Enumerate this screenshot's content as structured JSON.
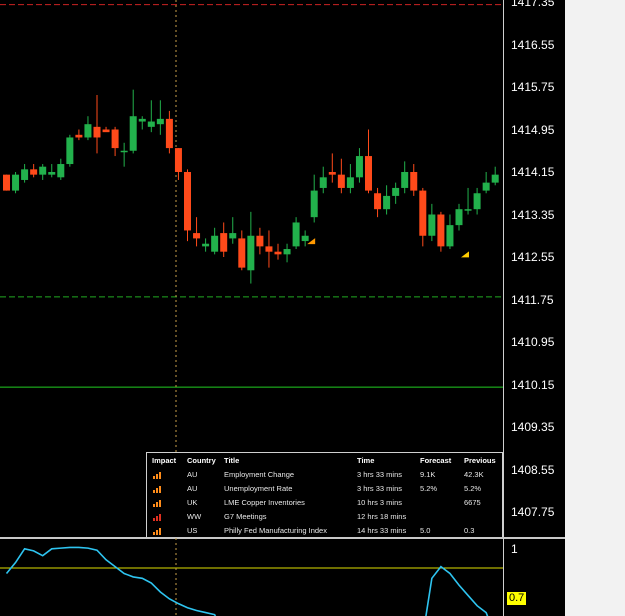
{
  "price_scale": {
    "labels": [
      "1417.35",
      "1416.55",
      "1415.75",
      "1414.95",
      "1414.15",
      "1413.35",
      "1412.55",
      "1411.75",
      "1410.95",
      "1410.15",
      "1409.35",
      "1408.55",
      "1407.75"
    ]
  },
  "news_table": {
    "headers": {
      "impact": "Impact",
      "country": "Country",
      "title": "Title",
      "time": "Time",
      "forecast": "Forecast",
      "previous": "Previous"
    },
    "rows": [
      {
        "impact": "medium",
        "country": "AU",
        "title": "Employment Change",
        "time": "3 hrs 33 mins",
        "forecast": "9.1K",
        "previous": "42.3K"
      },
      {
        "impact": "medium",
        "country": "AU",
        "title": "Unemployment Rate",
        "time": "3 hrs 33 mins",
        "forecast": "5.2%",
        "previous": "5.2%"
      },
      {
        "impact": "medium",
        "country": "UK",
        "title": "LME Copper Inventories",
        "time": "10 hrs 3 mins",
        "forecast": "",
        "previous": "6675"
      },
      {
        "impact": "high",
        "country": "WW",
        "title": "G7 Meetings",
        "time": "12 hrs 18 mins",
        "forecast": "",
        "previous": ""
      },
      {
        "impact": "medium",
        "country": "US",
        "title": "Philly Fed Manufacturing Index",
        "time": "14 hrs 33 mins",
        "forecast": "5.0",
        "previous": "0.3"
      }
    ]
  },
  "indicator": {
    "label_top": "1",
    "label_level": "0.7",
    "level": 0.7
  },
  "chart_data": {
    "type": "candlestick",
    "y_axis_ticks": [
      1417.35,
      1416.55,
      1415.75,
      1414.95,
      1414.15,
      1413.35,
      1412.55,
      1411.75,
      1410.95,
      1410.15,
      1409.35,
      1408.55,
      1407.75
    ],
    "horizontal_lines": [
      {
        "price": 1417.3,
        "color": "#cc2222",
        "style": "dashed"
      },
      {
        "price": 1411.8,
        "color": "#22aa22",
        "style": "dashed"
      },
      {
        "price": 1410.1,
        "color": "#22cc22",
        "style": "solid"
      }
    ],
    "candles": [
      {
        "o": 1414.1,
        "h": 1414.1,
        "l": 1413.8,
        "c": 1413.8
      },
      {
        "o": 1413.8,
        "h": 1414.15,
        "l": 1413.75,
        "c": 1414.1
      },
      {
        "o": 1414.0,
        "h": 1414.3,
        "l": 1413.95,
        "c": 1414.2
      },
      {
        "o": 1414.2,
        "h": 1414.3,
        "l": 1414.05,
        "c": 1414.1
      },
      {
        "o": 1414.1,
        "h": 1414.3,
        "l": 1414.0,
        "c": 1414.25
      },
      {
        "o": 1414.1,
        "h": 1414.3,
        "l": 1414.05,
        "c": 1414.15
      },
      {
        "o": 1414.05,
        "h": 1414.4,
        "l": 1414.0,
        "c": 1414.3
      },
      {
        "o": 1414.3,
        "h": 1414.85,
        "l": 1414.25,
        "c": 1414.8
      },
      {
        "o": 1414.85,
        "h": 1414.95,
        "l": 1414.75,
        "c": 1414.8
      },
      {
        "o": 1414.8,
        "h": 1415.2,
        "l": 1414.75,
        "c": 1415.05
      },
      {
        "o": 1415.0,
        "h": 1415.6,
        "l": 1414.5,
        "c": 1414.8
      },
      {
        "o": 1414.95,
        "h": 1415.0,
        "l": 1414.95,
        "c": 1414.9
      },
      {
        "o": 1414.95,
        "h": 1415.0,
        "l": 1414.45,
        "c": 1414.6
      },
      {
        "o": 1414.55,
        "h": 1414.7,
        "l": 1414.25,
        "c": 1414.55
      },
      {
        "o": 1414.55,
        "h": 1415.7,
        "l": 1414.5,
        "c": 1415.2
      },
      {
        "o": 1415.1,
        "h": 1415.2,
        "l": 1414.95,
        "c": 1415.15
      },
      {
        "o": 1415.0,
        "h": 1415.5,
        "l": 1414.9,
        "c": 1415.1
      },
      {
        "o": 1415.05,
        "h": 1415.5,
        "l": 1414.85,
        "c": 1415.15
      },
      {
        "o": 1415.15,
        "h": 1415.3,
        "l": 1414.5,
        "c": 1414.6
      },
      {
        "o": 1414.6,
        "h": 1414.6,
        "l": 1414.0,
        "c": 1414.15
      },
      {
        "o": 1414.15,
        "h": 1414.2,
        "l": 1412.85,
        "c": 1413.05
      },
      {
        "o": 1413.0,
        "h": 1413.3,
        "l": 1412.75,
        "c": 1412.9
      },
      {
        "o": 1412.75,
        "h": 1412.9,
        "l": 1412.65,
        "c": 1412.8
      },
      {
        "o": 1412.65,
        "h": 1413.1,
        "l": 1412.6,
        "c": 1412.95
      },
      {
        "o": 1413.0,
        "h": 1413.2,
        "l": 1412.55,
        "c": 1412.65
      },
      {
        "o": 1412.9,
        "h": 1413.3,
        "l": 1412.8,
        "c": 1413.0
      },
      {
        "o": 1412.9,
        "h": 1413.05,
        "l": 1412.3,
        "c": 1412.35
      },
      {
        "o": 1412.3,
        "h": 1413.4,
        "l": 1412.05,
        "c": 1412.95
      },
      {
        "o": 1412.95,
        "h": 1413.1,
        "l": 1412.6,
        "c": 1412.75
      },
      {
        "o": 1412.75,
        "h": 1413.05,
        "l": 1412.35,
        "c": 1412.65
      },
      {
        "o": 1412.65,
        "h": 1412.8,
        "l": 1412.5,
        "c": 1412.6
      },
      {
        "o": 1412.6,
        "h": 1412.8,
        "l": 1412.45,
        "c": 1412.7
      },
      {
        "o": 1412.75,
        "h": 1413.3,
        "l": 1412.7,
        "c": 1413.2
      },
      {
        "o": 1412.85,
        "h": 1413.05,
        "l": 1412.75,
        "c": 1412.95
      },
      {
        "o": 1413.3,
        "h": 1414.1,
        "l": 1413.2,
        "c": 1413.8
      },
      {
        "o": 1413.85,
        "h": 1414.25,
        "l": 1413.75,
        "c": 1414.05
      },
      {
        "o": 1414.15,
        "h": 1414.5,
        "l": 1413.95,
        "c": 1414.1
      },
      {
        "o": 1414.1,
        "h": 1414.4,
        "l": 1413.75,
        "c": 1413.85
      },
      {
        "o": 1413.85,
        "h": 1414.3,
        "l": 1413.75,
        "c": 1414.05
      },
      {
        "o": 1414.05,
        "h": 1414.6,
        "l": 1413.95,
        "c": 1414.45
      },
      {
        "o": 1414.45,
        "h": 1414.95,
        "l": 1413.75,
        "c": 1413.8
      },
      {
        "o": 1413.75,
        "h": 1413.85,
        "l": 1413.3,
        "c": 1413.45
      },
      {
        "o": 1413.45,
        "h": 1413.9,
        "l": 1413.35,
        "c": 1413.7
      },
      {
        "o": 1413.7,
        "h": 1413.95,
        "l": 1413.55,
        "c": 1413.85
      },
      {
        "o": 1413.85,
        "h": 1414.35,
        "l": 1413.75,
        "c": 1414.15
      },
      {
        "o": 1414.15,
        "h": 1414.3,
        "l": 1413.7,
        "c": 1413.8
      },
      {
        "o": 1413.8,
        "h": 1413.85,
        "l": 1412.75,
        "c": 1412.95
      },
      {
        "o": 1412.95,
        "h": 1413.55,
        "l": 1412.85,
        "c": 1413.35
      },
      {
        "o": 1413.35,
        "h": 1413.4,
        "l": 1412.65,
        "c": 1412.75
      },
      {
        "o": 1412.75,
        "h": 1413.35,
        "l": 1412.7,
        "c": 1413.15
      },
      {
        "o": 1413.15,
        "h": 1413.55,
        "l": 1413.05,
        "c": 1413.45
      },
      {
        "o": 1413.45,
        "h": 1413.85,
        "l": 1413.35,
        "c": 1413.45
      },
      {
        "o": 1413.45,
        "h": 1413.85,
        "l": 1413.35,
        "c": 1413.75
      },
      {
        "o": 1413.8,
        "h": 1414.15,
        "l": 1413.75,
        "c": 1413.95
      },
      {
        "o": 1413.95,
        "h": 1414.25,
        "l": 1413.9,
        "c": 1414.1
      }
    ],
    "markers": [
      {
        "candle": 33,
        "price": 1412.85,
        "color": "#ff9900"
      },
      {
        "candle": 50,
        "price": 1412.6,
        "color": "#ffcc00"
      }
    ],
    "indicator_series": [
      0.62,
      0.78,
      0.98,
      0.95,
      0.88,
      0.98,
      0.99,
      1.0,
      1.0,
      0.99,
      0.96,
      0.82,
      0.72,
      0.62,
      0.57,
      0.55,
      0.48,
      0.35,
      0.25,
      0.18,
      0.12,
      0.08,
      0.05,
      0.02,
      0.0,
      0.0,
      0.0,
      0.0,
      0.0,
      0.0,
      0.0,
      0.0,
      0.0,
      0.0,
      0.0,
      0.0,
      0.0,
      0.0,
      0.0,
      0.0,
      0.0,
      0.0,
      0.0,
      0.0,
      0.0,
      0.0,
      0.0,
      0.55,
      0.72,
      0.62,
      0.45,
      0.3,
      0.15,
      0.05,
      0.0
    ],
    "indicator_ylim": [
      0,
      1.05
    ]
  }
}
